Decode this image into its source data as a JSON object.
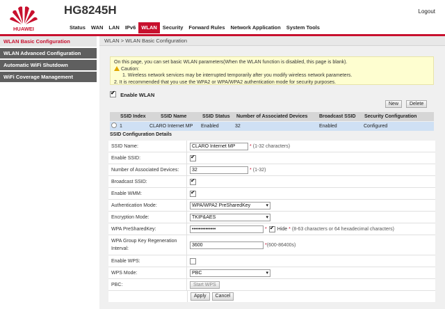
{
  "header": {
    "brand": "HUAWEI",
    "model": "HG8245H",
    "logout_label": "Logout"
  },
  "nav": [
    "Status",
    "WAN",
    "LAN",
    "IPv6",
    "WLAN",
    "Security",
    "Forward Rules",
    "Network Application",
    "System Tools"
  ],
  "nav_active": "WLAN",
  "sidebar": [
    "WLAN Basic Configuration",
    "WLAN Advanced Configuration",
    "Automatic WiFi Shutdown",
    "WiFi Coverage Management"
  ],
  "breadcrumb": "WLAN > WLAN Basic Configuration",
  "notice": {
    "intro": "On this page, you can set basic WLAN parameters(When the WLAN function is disabled, this page is blank).",
    "caution": "Caution:",
    "line1": "1. Wireless network services may be interrupted temporarily after you modify wireless network parameters.",
    "line2": "2. It is recommended that you use the WPA2 or WPA/WPA2 authentication mode for security purposes."
  },
  "enable_wlan_label": "Enable WLAN",
  "enable_wlan_checked": true,
  "buttons": {
    "new": "New",
    "delete": "Delete",
    "apply": "Apply",
    "cancel": "Cancel",
    "start_wps": "Start WPS"
  },
  "table": {
    "headers": [
      "SSID Index",
      "SSID Name",
      "SSID Status",
      "Number of Associated Devices",
      "Broadcast SSID",
      "Security Configuration"
    ],
    "rows": [
      [
        "1",
        "CLARO Internet MP",
        "Enabled",
        "32",
        "Enabled",
        "Configured"
      ]
    ]
  },
  "details_title": "SSID Configuration Details",
  "form": {
    "ssid_name_label": "SSID Name:",
    "ssid_name_value": "CLARO Internet MP",
    "ssid_name_hint": "(1-32 characters)",
    "enable_ssid_label": "Enable SSID:",
    "assoc_label": "Number of Associated Devices:",
    "assoc_value": "32",
    "assoc_hint": "(1-32)",
    "broadcast_label": "Broadcast SSID:",
    "wmm_label": "Enable WMM:",
    "auth_label": "Authentication Mode:",
    "auth_value": "WPA/WPA2 PreSharedKey",
    "enc_label": "Encryption Mode:",
    "enc_value": "TKIP&AES",
    "psk_label": "WPA PreSharedKey:",
    "psk_value": "••••••••••••••",
    "psk_hide": "Hide",
    "psk_hint": "(8-63 characters or 64 hexadecimal characters)",
    "regen_label": "WPA Group Key Regeneration Interval:",
    "regen_value": "3600",
    "regen_hint": "(600-86400s)",
    "enable_wps_label": "Enable WPS:",
    "wps_mode_label": "WPS Mode:",
    "wps_mode_value": "PBC",
    "pbc_label": "PBC:",
    "req_mark": "*"
  }
}
